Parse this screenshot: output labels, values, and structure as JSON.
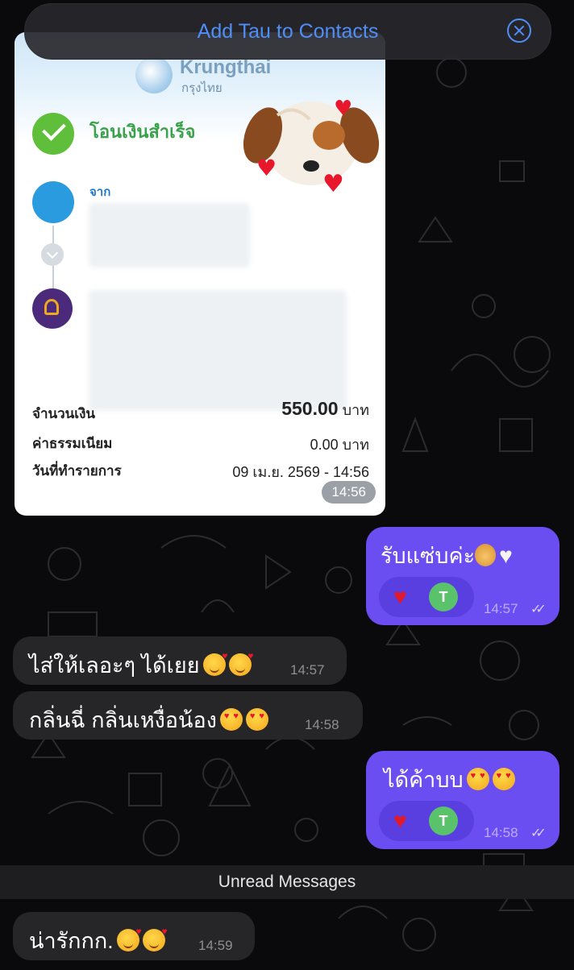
{
  "banner": {
    "title": "Add Tau to Contacts",
    "close_icon": "close-circle-icon"
  },
  "receipt": {
    "bank_name": "Krungthai",
    "bank_name_th": "กรุงไทย",
    "status": "โอนเงินสำเร็จ",
    "from_label": "จาก",
    "amount_label": "จำนวนเงิน",
    "amount_value": "550.00",
    "amount_unit": "บาท",
    "fee_label": "ค่าธรรมเนียม",
    "fee_value": "0.00 บาท",
    "date_label": "วันที่ทำรายการ",
    "date_value": "09 เม.ย. 2569 - 14:56",
    "time": "14:56"
  },
  "messages": [
    {
      "direction": "out",
      "text": "รับแซ่บค่ะ",
      "time": "14:57",
      "reaction": "heart",
      "reactor_initial": "T"
    },
    {
      "direction": "in",
      "text": "ไส่ให้เลอะๆ ได้เยย",
      "time": "14:57"
    },
    {
      "direction": "in",
      "text": "กลิ่นฉี่ กลิ่นเหงื่อน้อง",
      "time": "14:58"
    },
    {
      "direction": "out",
      "text": "ได้ค้าบบ",
      "time": "14:58",
      "reaction": "heart",
      "reactor_initial": "T"
    },
    {
      "direction": "in",
      "text": "น่ารักกก.",
      "time": "14:59"
    }
  ],
  "unread_label": "Unread Messages",
  "colors": {
    "outgoing_bubble": "#6a4ef2",
    "incoming_bubble": "#262628",
    "link": "#4f8ef7",
    "success": "#3aa24a"
  }
}
